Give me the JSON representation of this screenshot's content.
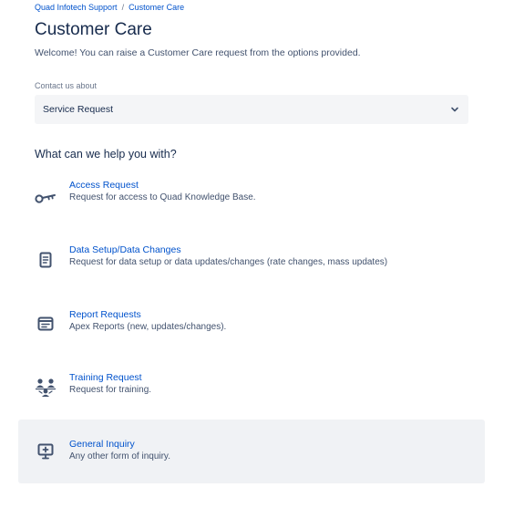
{
  "breadcrumb": {
    "portal": "Quad Infotech Support",
    "separator": "/",
    "current": "Customer Care"
  },
  "page": {
    "title": "Customer Care",
    "welcome": "Welcome! You can raise a Customer Care request from the options provided."
  },
  "contact": {
    "label": "Contact us about",
    "selected": "Service Request"
  },
  "section": {
    "heading": "What can we help you with?"
  },
  "options": [
    {
      "title": "Access Request",
      "description": "Request for access to Quad Knowledge Base.",
      "icon": "key-icon"
    },
    {
      "title": "Data Setup/Data Changes",
      "description": "Request for data setup or data updates/changes (rate changes, mass updates)",
      "icon": "document-icon"
    },
    {
      "title": "Report Requests",
      "description": "Apex Reports (new, updates/changes).",
      "icon": "report-icon"
    },
    {
      "title": "Training Request",
      "description": "Request for training.",
      "icon": "training-icon"
    },
    {
      "title": "General Inquiry",
      "description": "Any other form of inquiry.",
      "icon": "inquiry-icon"
    }
  ],
  "colors": {
    "link": "#0052cc",
    "text": "#172b4d",
    "subtle_text": "#42526e",
    "select_bg": "#f4f5f7",
    "hover_bg": "#f0f2f5"
  }
}
